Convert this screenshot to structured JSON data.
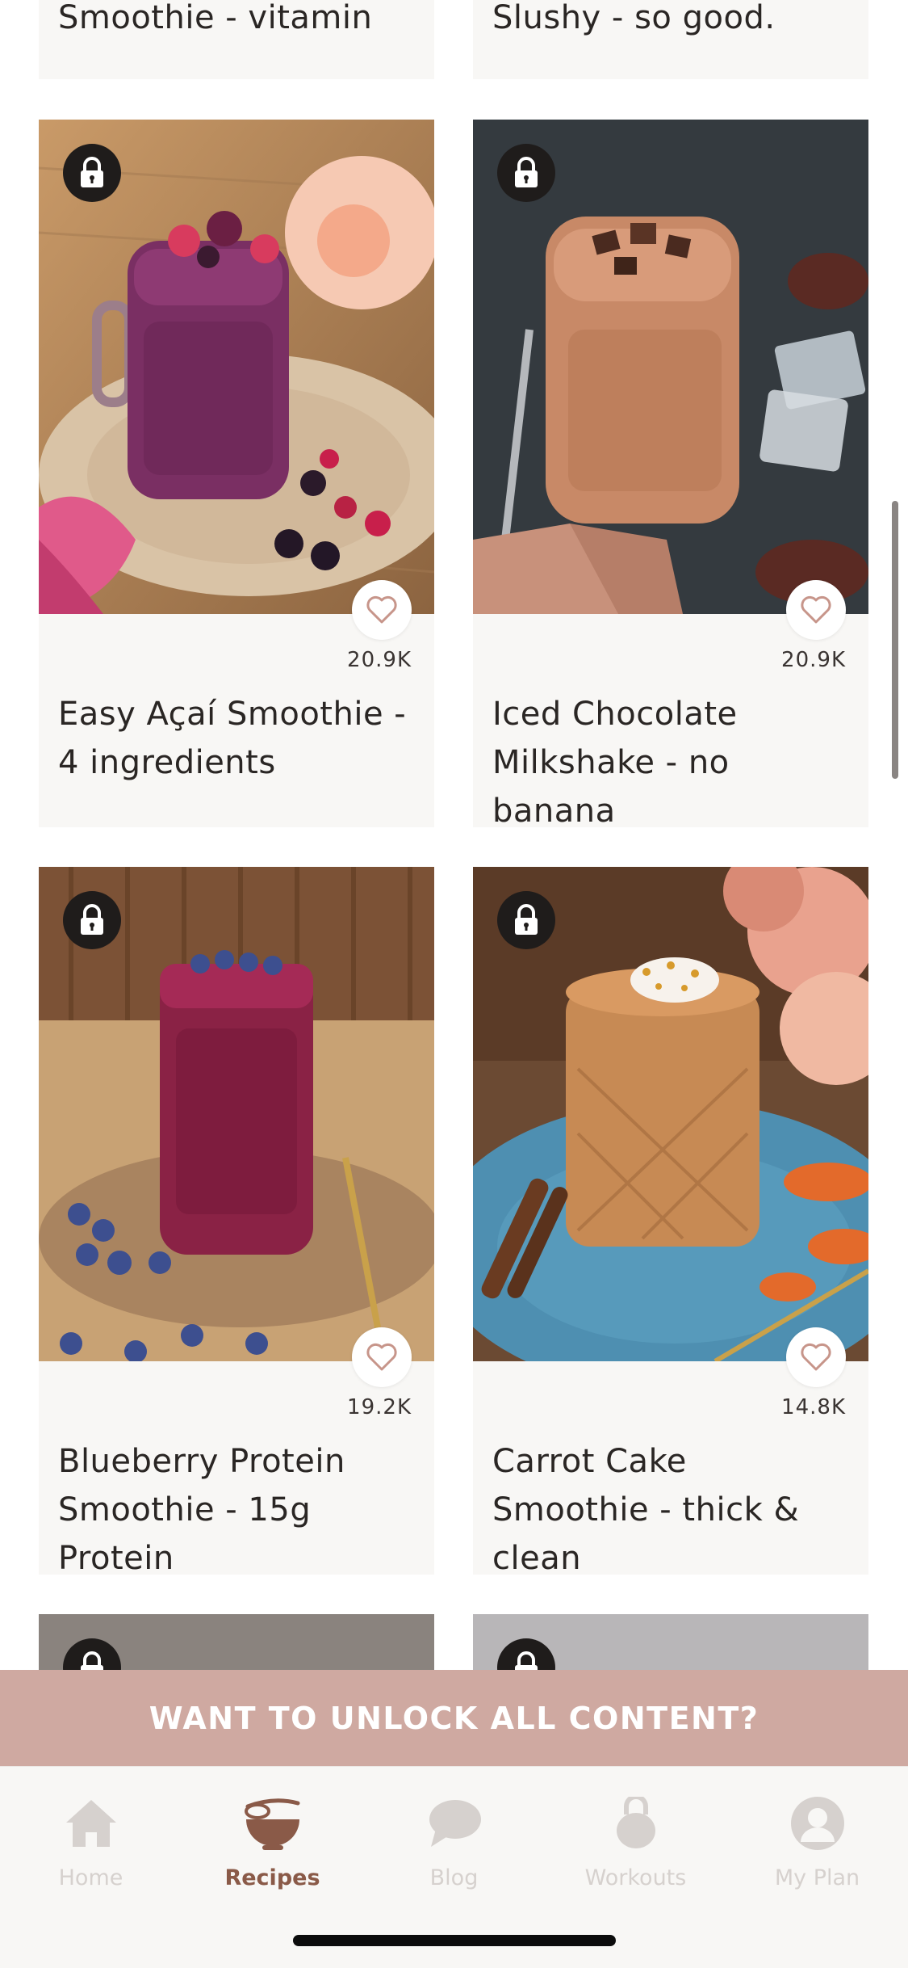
{
  "top_cards": [
    {
      "title_tail": "Smoothie - vitamin"
    },
    {
      "title_tail": "Slushy - so good."
    }
  ],
  "recipes": [
    {
      "title": "Easy Açaí Smoothie - 4 ingredients",
      "likes": "20.9K",
      "locked": true
    },
    {
      "title": "Iced Chocolate Milkshake - no banana",
      "likes": "20.9K",
      "locked": true
    },
    {
      "title": "Blueberry Protein Smoothie - 15g Protein",
      "likes": "19.2K",
      "locked": true
    },
    {
      "title": "Carrot Cake Smoothie - thick & clean",
      "likes": "14.8K",
      "locked": true
    }
  ],
  "banner": {
    "label": "WANT TO UNLOCK ALL CONTENT?"
  },
  "tabbar": {
    "items": [
      {
        "label": "Home",
        "icon": "home-icon",
        "active": false
      },
      {
        "label": "Recipes",
        "icon": "bowl-whisk-icon",
        "active": true
      },
      {
        "label": "Blog",
        "icon": "chat-bubble-icon",
        "active": false
      },
      {
        "label": "Workouts",
        "icon": "kettlebell-icon",
        "active": false
      },
      {
        "label": "My Plan",
        "icon": "profile-icon",
        "active": false
      }
    ]
  },
  "colors": {
    "accent": "#8a5a48",
    "banner": "#cfa9a1",
    "card_bg": "#f8f7f5",
    "inactive_tab": "#d6d1ce",
    "heart": "#c7958a"
  }
}
